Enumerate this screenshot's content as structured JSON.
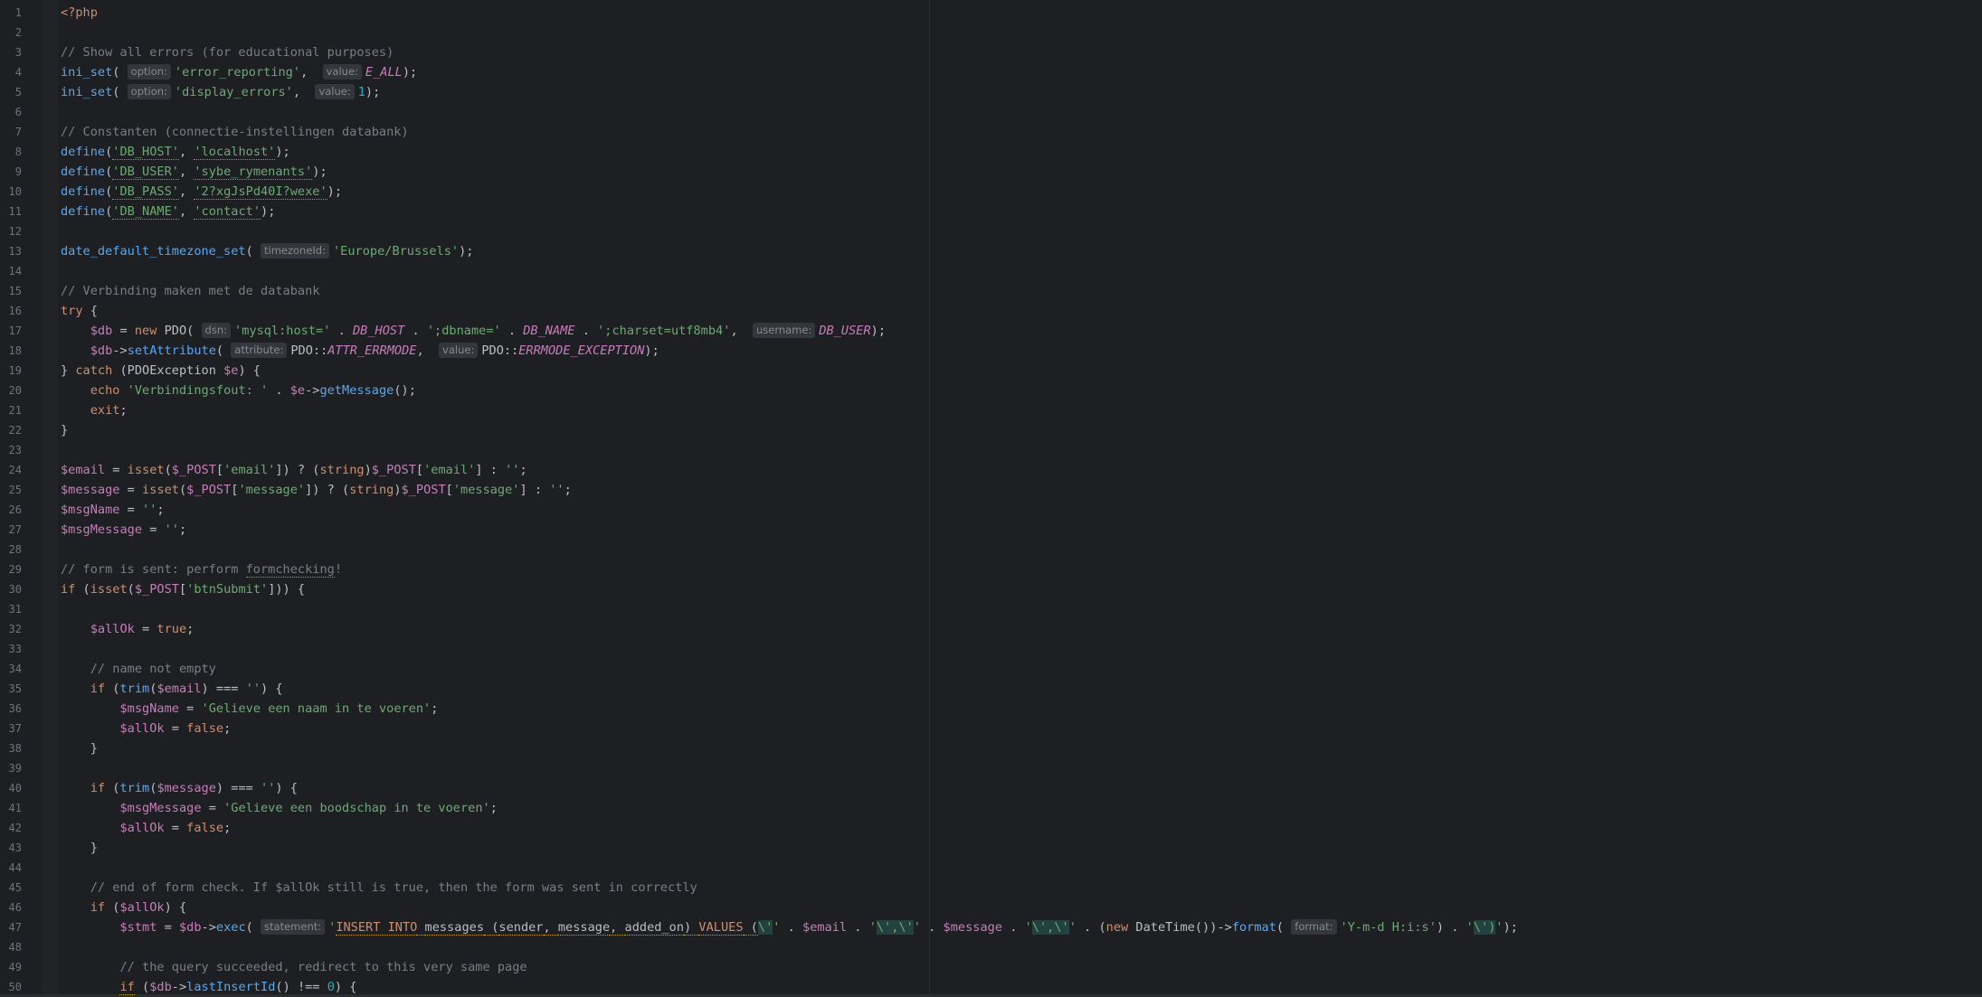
{
  "editor": {
    "language": "php",
    "lines": [
      [
        {
          "t": "<?php",
          "c": "kw"
        }
      ],
      [],
      [
        {
          "t": "// Show all errors (for educational purposes)",
          "c": "cmt"
        }
      ],
      [
        {
          "t": "ini_set",
          "c": "fn"
        },
        {
          "t": "( ",
          "c": "op"
        },
        {
          "t": "option:",
          "c": "hint"
        },
        {
          "t": "'error_reporting'",
          "c": "str"
        },
        {
          "t": ",  ",
          "c": "op"
        },
        {
          "t": "value:",
          "c": "hint"
        },
        {
          "t": "E_ALL",
          "c": "cst"
        },
        {
          "t": ");",
          "c": "op"
        }
      ],
      [
        {
          "t": "ini_set",
          "c": "fn"
        },
        {
          "t": "( ",
          "c": "op"
        },
        {
          "t": "option:",
          "c": "hint"
        },
        {
          "t": "'display_errors'",
          "c": "str"
        },
        {
          "t": ",  ",
          "c": "op"
        },
        {
          "t": "value:",
          "c": "hint"
        },
        {
          "t": "1",
          "c": "num"
        },
        {
          "t": ");",
          "c": "op"
        }
      ],
      [],
      [
        {
          "t": "// Constanten (connectie-instellingen databank)",
          "c": "cmt"
        }
      ],
      [
        {
          "t": "define",
          "c": "fn"
        },
        {
          "t": "(",
          "c": "op"
        },
        {
          "t": "'DB_HOST'",
          "c": "str dotted"
        },
        {
          "t": ", ",
          "c": "op"
        },
        {
          "t": "'localhost'",
          "c": "str dotted"
        },
        {
          "t": ");",
          "c": "op"
        }
      ],
      [
        {
          "t": "define",
          "c": "fn"
        },
        {
          "t": "(",
          "c": "op"
        },
        {
          "t": "'DB_USER'",
          "c": "str dotted"
        },
        {
          "t": ", ",
          "c": "op"
        },
        {
          "t": "'sybe_rymenants'",
          "c": "str dotted"
        },
        {
          "t": ");",
          "c": "op"
        }
      ],
      [
        {
          "t": "define",
          "c": "fn"
        },
        {
          "t": "(",
          "c": "op"
        },
        {
          "t": "'DB_PASS'",
          "c": "str dotted"
        },
        {
          "t": ", ",
          "c": "op"
        },
        {
          "t": "'2?xgJsPd40I?wexe'",
          "c": "str dotted"
        },
        {
          "t": ");",
          "c": "op"
        }
      ],
      [
        {
          "t": "define",
          "c": "fn"
        },
        {
          "t": "(",
          "c": "op"
        },
        {
          "t": "'DB_NAME'",
          "c": "str dotted"
        },
        {
          "t": ", ",
          "c": "op"
        },
        {
          "t": "'contact'",
          "c": "str dotted"
        },
        {
          "t": ");",
          "c": "op"
        }
      ],
      [],
      [
        {
          "t": "date_default_timezone_set",
          "c": "fn"
        },
        {
          "t": "( ",
          "c": "op"
        },
        {
          "t": "timezoneId:",
          "c": "hint"
        },
        {
          "t": "'Europe/Brussels'",
          "c": "str"
        },
        {
          "t": ");",
          "c": "op"
        }
      ],
      [],
      [
        {
          "t": "// Verbinding maken met de databank",
          "c": "cmt"
        }
      ],
      [
        {
          "t": "try",
          "c": "kw"
        },
        {
          "t": " {",
          "c": "op"
        }
      ],
      [
        {
          "t": "    ",
          "c": "op"
        },
        {
          "t": "$db",
          "c": "var"
        },
        {
          "t": " = ",
          "c": "op"
        },
        {
          "t": "new",
          "c": "kw"
        },
        {
          "t": " PDO( ",
          "c": "cls"
        },
        {
          "t": "dsn:",
          "c": "hint"
        },
        {
          "t": "'mysql:host='",
          "c": "str"
        },
        {
          "t": " . ",
          "c": "op"
        },
        {
          "t": "DB_HOST",
          "c": "cst"
        },
        {
          "t": " . ",
          "c": "op"
        },
        {
          "t": "';dbname='",
          "c": "str"
        },
        {
          "t": " . ",
          "c": "op"
        },
        {
          "t": "DB_NAME",
          "c": "cst"
        },
        {
          "t": " . ",
          "c": "op"
        },
        {
          "t": "';charset=utf8mb4'",
          "c": "str"
        },
        {
          "t": ",  ",
          "c": "op"
        },
        {
          "t": "username:",
          "c": "hint"
        },
        {
          "t": "DB_USER",
          "c": "cst"
        },
        {
          "t": ");",
          "c": "op"
        }
      ],
      [
        {
          "t": "    ",
          "c": "op"
        },
        {
          "t": "$db",
          "c": "var"
        },
        {
          "t": "->",
          "c": "op"
        },
        {
          "t": "setAttribute",
          "c": "fn"
        },
        {
          "t": "( ",
          "c": "op"
        },
        {
          "t": "attribute:",
          "c": "hint"
        },
        {
          "t": "PDO::",
          "c": "cls"
        },
        {
          "t": "ATTR_ERRMODE",
          "c": "cst"
        },
        {
          "t": ",  ",
          "c": "op"
        },
        {
          "t": "value:",
          "c": "hint"
        },
        {
          "t": "PDO::",
          "c": "cls"
        },
        {
          "t": "ERRMODE_EXCEPTION",
          "c": "cst"
        },
        {
          "t": ");",
          "c": "op"
        }
      ],
      [
        {
          "t": "} ",
          "c": "op"
        },
        {
          "t": "catch",
          "c": "kw"
        },
        {
          "t": " (PDOException ",
          "c": "cls"
        },
        {
          "t": "$e",
          "c": "var"
        },
        {
          "t": ") {",
          "c": "op"
        }
      ],
      [
        {
          "t": "    ",
          "c": "op"
        },
        {
          "t": "echo",
          "c": "kw"
        },
        {
          "t": " ",
          "c": "op"
        },
        {
          "t": "'Verbindingsfout: '",
          "c": "str"
        },
        {
          "t": " . ",
          "c": "op"
        },
        {
          "t": "$e",
          "c": "var"
        },
        {
          "t": "->",
          "c": "op"
        },
        {
          "t": "getMessage",
          "c": "fn"
        },
        {
          "t": "();",
          "c": "op"
        }
      ],
      [
        {
          "t": "    ",
          "c": "op"
        },
        {
          "t": "exit",
          "c": "kw"
        },
        {
          "t": ";",
          "c": "op"
        }
      ],
      [
        {
          "t": "}",
          "c": "op"
        }
      ],
      [],
      [
        {
          "t": "$email",
          "c": "var"
        },
        {
          "t": " = ",
          "c": "op"
        },
        {
          "t": "isset",
          "c": "kw"
        },
        {
          "t": "(",
          "c": "op"
        },
        {
          "t": "$_POST",
          "c": "var"
        },
        {
          "t": "[",
          "c": "op"
        },
        {
          "t": "'email'",
          "c": "str"
        },
        {
          "t": "]) ? (",
          "c": "op"
        },
        {
          "t": "string",
          "c": "kw"
        },
        {
          "t": ")",
          "c": "op"
        },
        {
          "t": "$_POST",
          "c": "var"
        },
        {
          "t": "[",
          "c": "op"
        },
        {
          "t": "'email'",
          "c": "str"
        },
        {
          "t": "] : ",
          "c": "op"
        },
        {
          "t": "''",
          "c": "str"
        },
        {
          "t": ";",
          "c": "op"
        }
      ],
      [
        {
          "t": "$message",
          "c": "var"
        },
        {
          "t": " = ",
          "c": "op"
        },
        {
          "t": "isset",
          "c": "kw"
        },
        {
          "t": "(",
          "c": "op"
        },
        {
          "t": "$_POST",
          "c": "var"
        },
        {
          "t": "[",
          "c": "op"
        },
        {
          "t": "'message'",
          "c": "str"
        },
        {
          "t": "]) ? (",
          "c": "op"
        },
        {
          "t": "string",
          "c": "kw"
        },
        {
          "t": ")",
          "c": "op"
        },
        {
          "t": "$_POST",
          "c": "var"
        },
        {
          "t": "[",
          "c": "op"
        },
        {
          "t": "'message'",
          "c": "str"
        },
        {
          "t": "] : ",
          "c": "op"
        },
        {
          "t": "''",
          "c": "str"
        },
        {
          "t": ";",
          "c": "op"
        }
      ],
      [
        {
          "t": "$msgName",
          "c": "var"
        },
        {
          "t": " = ",
          "c": "op"
        },
        {
          "t": "''",
          "c": "str"
        },
        {
          "t": ";",
          "c": "op"
        }
      ],
      [
        {
          "t": "$msgMessage",
          "c": "var"
        },
        {
          "t": " = ",
          "c": "op"
        },
        {
          "t": "''",
          "c": "str"
        },
        {
          "t": ";",
          "c": "op"
        }
      ],
      [],
      [
        {
          "t": "// form is sent: perform ",
          "c": "cmt"
        },
        {
          "t": "formchecking",
          "c": "cmt squig"
        },
        {
          "t": "!",
          "c": "cmt"
        }
      ],
      [
        {
          "t": "if",
          "c": "kw"
        },
        {
          "t": " (",
          "c": "op"
        },
        {
          "t": "isset",
          "c": "kw"
        },
        {
          "t": "(",
          "c": "op"
        },
        {
          "t": "$_POST",
          "c": "var"
        },
        {
          "t": "[",
          "c": "op"
        },
        {
          "t": "'btnSubmit'",
          "c": "str"
        },
        {
          "t": "])) {",
          "c": "op"
        }
      ],
      [],
      [
        {
          "t": "    ",
          "c": "op"
        },
        {
          "t": "$allOk",
          "c": "var"
        },
        {
          "t": " = ",
          "c": "op"
        },
        {
          "t": "true",
          "c": "kw"
        },
        {
          "t": ";",
          "c": "op"
        }
      ],
      [],
      [
        {
          "t": "    // name not empty",
          "c": "cmt"
        }
      ],
      [
        {
          "t": "    ",
          "c": "op"
        },
        {
          "t": "if",
          "c": "kw"
        },
        {
          "t": " (",
          "c": "op"
        },
        {
          "t": "trim",
          "c": "fn"
        },
        {
          "t": "(",
          "c": "op"
        },
        {
          "t": "$email",
          "c": "var"
        },
        {
          "t": ") === ",
          "c": "op"
        },
        {
          "t": "''",
          "c": "str"
        },
        {
          "t": ") {",
          "c": "op"
        }
      ],
      [
        {
          "t": "        ",
          "c": "op"
        },
        {
          "t": "$msgName",
          "c": "var"
        },
        {
          "t": " = ",
          "c": "op"
        },
        {
          "t": "'Gelieve een naam in te voeren'",
          "c": "str"
        },
        {
          "t": ";",
          "c": "op"
        }
      ],
      [
        {
          "t": "        ",
          "c": "op"
        },
        {
          "t": "$allOk",
          "c": "var"
        },
        {
          "t": " = ",
          "c": "op"
        },
        {
          "t": "false",
          "c": "kw"
        },
        {
          "t": ";",
          "c": "op"
        }
      ],
      [
        {
          "t": "    }",
          "c": "op"
        }
      ],
      [],
      [
        {
          "t": "    ",
          "c": "op"
        },
        {
          "t": "if",
          "c": "kw"
        },
        {
          "t": " (",
          "c": "op"
        },
        {
          "t": "trim",
          "c": "fn"
        },
        {
          "t": "(",
          "c": "op"
        },
        {
          "t": "$message",
          "c": "var"
        },
        {
          "t": ") === ",
          "c": "op"
        },
        {
          "t": "''",
          "c": "str"
        },
        {
          "t": ") {",
          "c": "op"
        }
      ],
      [
        {
          "t": "        ",
          "c": "op"
        },
        {
          "t": "$msgMessage",
          "c": "var"
        },
        {
          "t": " = ",
          "c": "op"
        },
        {
          "t": "'Gelieve een boodschap in te voeren'",
          "c": "str"
        },
        {
          "t": ";",
          "c": "op"
        }
      ],
      [
        {
          "t": "        ",
          "c": "op"
        },
        {
          "t": "$allOk",
          "c": "var"
        },
        {
          "t": " = ",
          "c": "op"
        },
        {
          "t": "false",
          "c": "kw"
        },
        {
          "t": ";",
          "c": "op"
        }
      ],
      [
        {
          "t": "    }",
          "c": "op"
        }
      ],
      [],
      [
        {
          "t": "    // end of form check. If $allOk still is true, then the form was sent in correctly",
          "c": "cmt"
        }
      ],
      [
        {
          "t": "    ",
          "c": "op"
        },
        {
          "t": "if",
          "c": "kw"
        },
        {
          "t": " (",
          "c": "op"
        },
        {
          "t": "$allOk",
          "c": "var"
        },
        {
          "t": ") {",
          "c": "op"
        }
      ],
      [
        {
          "t": "        ",
          "c": "op"
        },
        {
          "t": "$stmt",
          "c": "var"
        },
        {
          "t": " = ",
          "c": "op"
        },
        {
          "t": "$db",
          "c": "var"
        },
        {
          "t": "->",
          "c": "op"
        },
        {
          "t": "exec",
          "c": "fn"
        },
        {
          "t": "( ",
          "c": "op"
        },
        {
          "t": "statement:",
          "c": "hint"
        },
        {
          "t": "'",
          "c": "str"
        },
        {
          "t": "INSERT INTO",
          "c": "sqlkw"
        },
        {
          "t": " ",
          "c": "sqlid"
        },
        {
          "t": "messages",
          "c": "sqlid"
        },
        {
          "t": " (",
          "c": "sqlid"
        },
        {
          "t": "sender",
          "c": "sqlid"
        },
        {
          "t": ", ",
          "c": "sqlid"
        },
        {
          "t": "message",
          "c": "sqlid"
        },
        {
          "t": ", ",
          "c": "sqlid"
        },
        {
          "t": "added_on",
          "c": "sqlid"
        },
        {
          "t": ") ",
          "c": "sqlid"
        },
        {
          "t": "VALUES",
          "c": "sqlkw"
        },
        {
          "t": " (",
          "c": "sqlid"
        },
        {
          "t": "\\'",
          "c": "esc"
        },
        {
          "t": "'",
          "c": "str"
        },
        {
          "t": " . ",
          "c": "op"
        },
        {
          "t": "$email",
          "c": "var"
        },
        {
          "t": " . ",
          "c": "op"
        },
        {
          "t": "'",
          "c": "str"
        },
        {
          "t": "\\',\\'",
          "c": "esc"
        },
        {
          "t": "'",
          "c": "str"
        },
        {
          "t": " . ",
          "c": "op"
        },
        {
          "t": "$message",
          "c": "var"
        },
        {
          "t": " . ",
          "c": "op"
        },
        {
          "t": "'",
          "c": "str"
        },
        {
          "t": "\\',\\'",
          "c": "esc"
        },
        {
          "t": "'",
          "c": "str"
        },
        {
          "t": " . (",
          "c": "op"
        },
        {
          "t": "new",
          "c": "kw"
        },
        {
          "t": " DateTime())->",
          "c": "cls"
        },
        {
          "t": "format",
          "c": "fn"
        },
        {
          "t": "( ",
          "c": "op"
        },
        {
          "t": "format:",
          "c": "hint"
        },
        {
          "t": "'Y-m-d H:i:s'",
          "c": "str"
        },
        {
          "t": ") . ",
          "c": "op"
        },
        {
          "t": "'",
          "c": "str"
        },
        {
          "t": "\\')",
          "c": "esc"
        },
        {
          "t": "'",
          "c": "str"
        },
        {
          "t": ");",
          "c": "op"
        }
      ],
      [],
      [
        {
          "t": "        // the query succeeded, redirect to this very same page",
          "c": "cmt"
        }
      ],
      [
        {
          "t": "        ",
          "c": "op"
        },
        {
          "t": "if",
          "c": "kw warn"
        },
        {
          "t": " (",
          "c": "op"
        },
        {
          "t": "$db",
          "c": "var"
        },
        {
          "t": "->",
          "c": "op"
        },
        {
          "t": "lastInsertId",
          "c": "fn"
        },
        {
          "t": "() !== ",
          "c": "op"
        },
        {
          "t": "0",
          "c": "num"
        },
        {
          "t": ") {",
          "c": "op"
        }
      ]
    ]
  }
}
